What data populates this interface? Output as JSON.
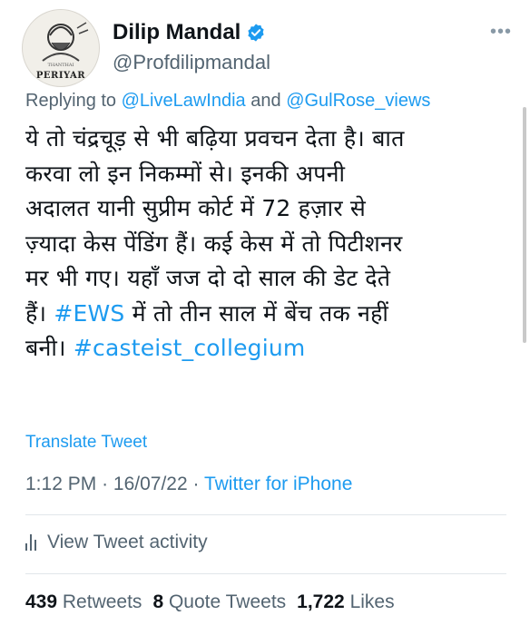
{
  "author": {
    "name": "Dilip Mandal",
    "handle": "@Profdilipmandal",
    "avatar_label": "PERIYAR",
    "avatar_sublabel": "THANTHAI"
  },
  "reply": {
    "prefix": "Replying to",
    "mention1": "@LiveLawIndia",
    "and": "and",
    "mention2": "@GulRose_views"
  },
  "tweet": {
    "lines": [
      "ये तो चंद्रचूड़ से भी बढ़िया प्रवचन देता है। बात",
      "करवा लो इन निकम्मों से। इनकी अपनी",
      "अदालत यानी सुप्रीम कोर्ट में 72 हज़ार से",
      "ज़्यादा केस पेंडिंग हैं। कई केस में तो पिटीशनर",
      "मर भी गए। यहाँ जज दो दो साल की डेट देते"
    ],
    "line6_pre": "हैं।",
    "hashtag1": "#EWS",
    "line6_post": "में तो तीन साल में बेंच तक नहीं",
    "line7_pre": "बनी।",
    "hashtag2": "#casteist_collegium"
  },
  "translate_label": "Translate Tweet",
  "meta": {
    "time": "1:12 PM",
    "sep1": "·",
    "date": "16/07/22",
    "sep2": "·",
    "source": "Twitter for iPhone"
  },
  "activity_label": "View Tweet activity",
  "stats": {
    "retweets_count": "439",
    "retweets_label": "Retweets",
    "quotes_count": "8",
    "quotes_label": "Quote Tweets",
    "likes_count": "1,722",
    "likes_label": "Likes"
  },
  "colors": {
    "link": "#1d9bf0",
    "secondary_text": "#536471",
    "primary_text": "#0f1419"
  },
  "icons": [
    "verified-badge-icon",
    "more-icon",
    "activity-bars-icon"
  ]
}
